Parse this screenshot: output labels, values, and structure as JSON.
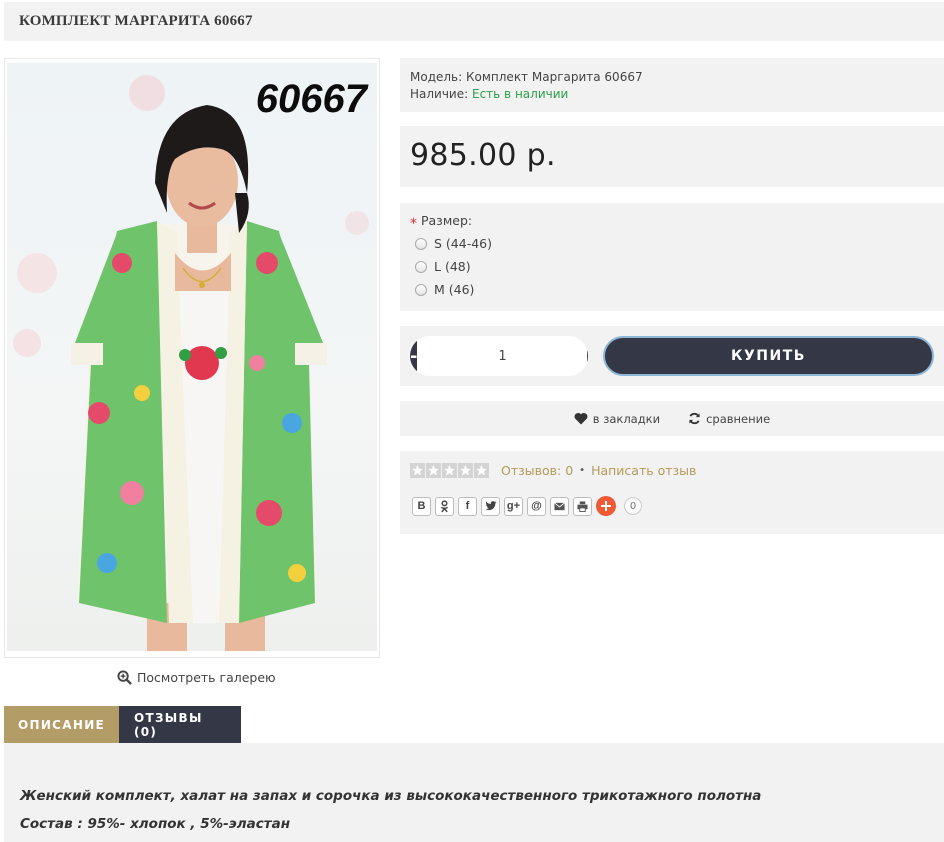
{
  "product": {
    "title": "КОМПЛЕКТ МАРГАРИТА 60667",
    "image_number": "60667",
    "gallery_link": "Посмотреть галерею"
  },
  "info": {
    "model_label": "Модель:",
    "model_value": "Комплект Маргарита 60667",
    "stock_label": "Наличие:",
    "stock_value": "Есть в наличии"
  },
  "price": "985.00 р.",
  "options": {
    "required_mark": "*",
    "label": "Размер:",
    "sizes": [
      "S (44-46)",
      "L (48)",
      "M (46)"
    ]
  },
  "cart": {
    "minus": "-",
    "quantity": "1",
    "plus": "+",
    "buy_label": "КУПИТЬ"
  },
  "links": {
    "wishlist": "в закладки",
    "compare": "сравнение"
  },
  "reviews": {
    "rating": 0,
    "max_rating": 5,
    "count_label": "Отзывов: 0",
    "separator": "•",
    "write_label": "Написать отзыв"
  },
  "share": {
    "buttons": [
      "В",
      "ok-icon",
      "f",
      "twitter-icon",
      "g+",
      "@",
      "mail-icon",
      "print-icon"
    ],
    "count": "0"
  },
  "tabs": [
    {
      "label": "ОПИСАНИЕ",
      "active": true
    },
    {
      "label": "ОТЗЫВЫ (0)",
      "active": false
    }
  ],
  "description": {
    "line1": "Женский комплект, халат на запах и сорочка из высококачественного трикотажного полотна",
    "line2": "Состав : 95%- хлопок , 5%-эластан"
  },
  "colors": {
    "accent_gold": "#b39c66",
    "dark_button": "#343746",
    "in_stock_green": "#2aa04b",
    "panel_bg": "#f2f2f2"
  }
}
